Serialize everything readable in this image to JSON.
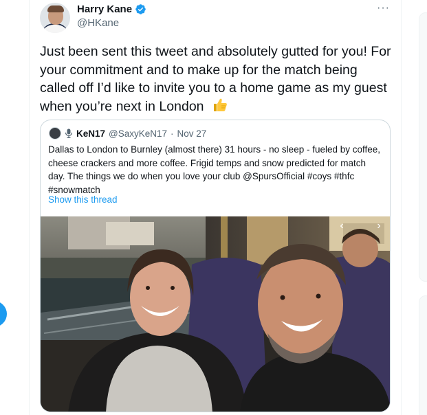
{
  "tweet": {
    "author_name": "Harry Kane",
    "author_handle": "@HKane",
    "more_icon": "more-icon",
    "text": "Just been sent this tweet and absolutely gutted for you! For your commitment and to make up for the match being called off I’d like to invite you to a home game as my guest when you’re next in London",
    "emoji": "thumbs-up-icon"
  },
  "quoted": {
    "author_name": "KeN17",
    "author_handle": "@SaxyKeN17",
    "separator": "·",
    "date": "Nov 27",
    "text": "Dallas to London to Burnley (almost there) 31 hours - no sleep - fueled by coffee, cheese crackers and more coffee.  Frigid temps and snow predicted for match day. The things we do when you love your club @SpursOfficial #coys #thfc #snowmatch",
    "show_thread": "Show this thread",
    "photo_icon": "selfie-photo"
  },
  "colors": {
    "accent": "#1d9bf0",
    "text": "#0f1419",
    "muted": "#536471",
    "border": "#cfd9de"
  }
}
